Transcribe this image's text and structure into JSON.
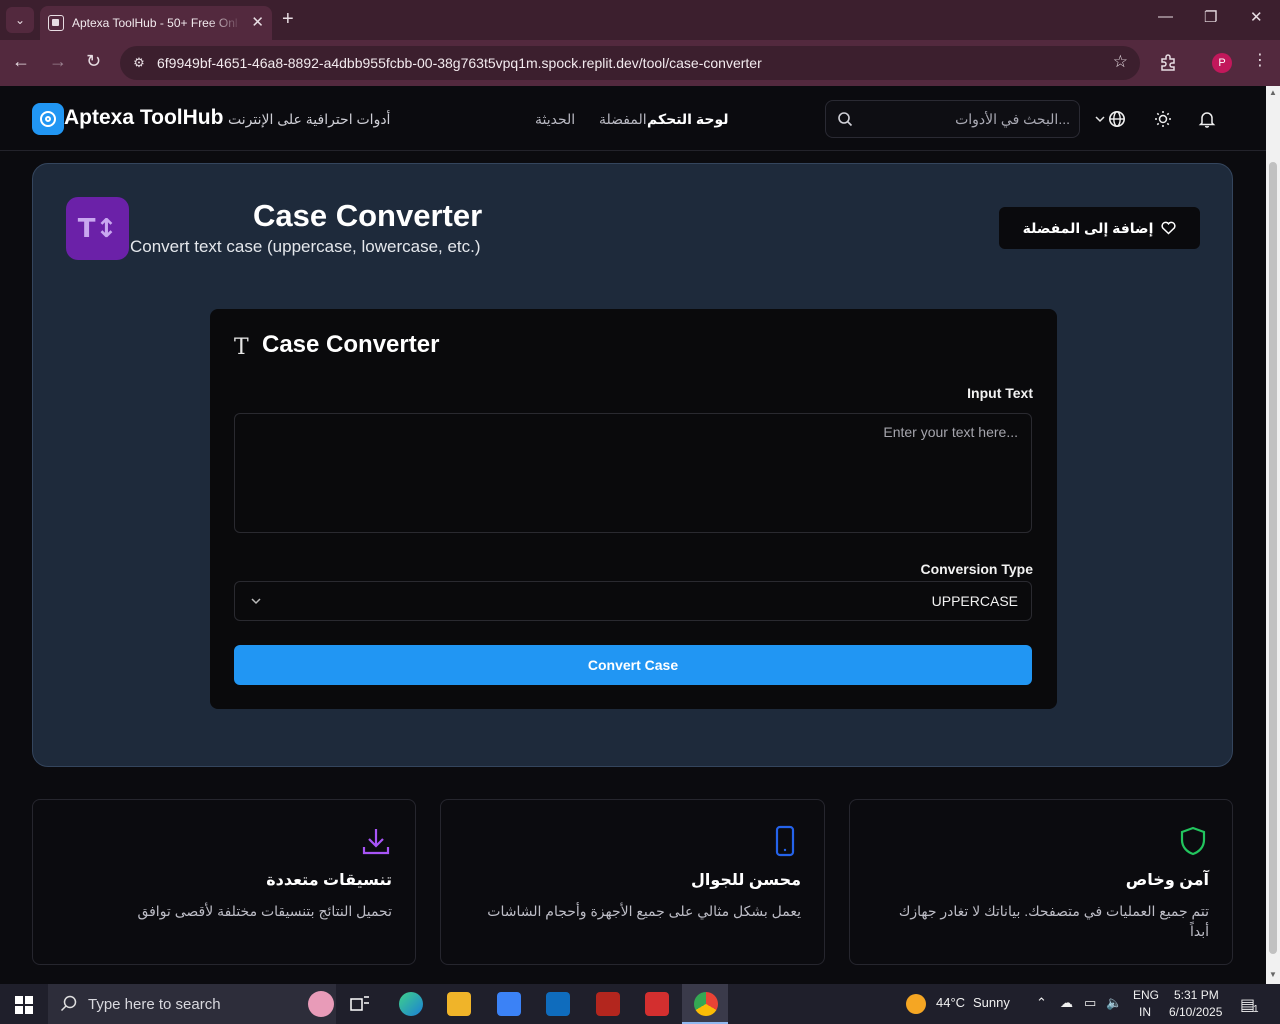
{
  "browser": {
    "tab_title": "Aptexa ToolHub - 50+ Free Onl",
    "url": "6f9949bf-4651-46a8-8892-a4dbb955fcbb-00-38g763t5vpq1m.spock.replit.dev/tool/case-converter",
    "profile_initial": "P"
  },
  "header": {
    "brand": "Aptexa ToolHub",
    "tagline": "أدوات احترافية على الإنترنت",
    "nav": [
      "الحديثة",
      "المفضلة",
      "لوحة التحكم"
    ],
    "search_placeholder": "البحث في الأدوات..."
  },
  "tool": {
    "icon_glyph": "T↕",
    "title": "Case Converter",
    "description": "Convert text case (uppercase, lowercase, etc.)",
    "favorite_label": "إضافة إلى المفضلة"
  },
  "card": {
    "title": "Case Converter",
    "input_label": "Input Text",
    "input_placeholder": "Enter your text here...",
    "conversion_label": "Conversion Type",
    "conversion_value": "UPPERCASE",
    "button_label": "Convert Case"
  },
  "features": [
    {
      "title": "آمن وخاص",
      "desc": "تتم جميع العمليات في متصفحك. بياناتك لا تغادر جهازك أبداً",
      "color": "#22c55e"
    },
    {
      "title": "محسن للجوال",
      "desc": "يعمل بشكل مثالي على جميع الأجهزة وأحجام الشاشات",
      "color": "#2563eb"
    },
    {
      "title": "تنسيقات متعددة",
      "desc": "تحميل النتائج بتنسيقات مختلفة لأقصى توافق",
      "color": "#a855f7"
    }
  ],
  "taskbar": {
    "search_text": "Type here to search",
    "weather_temp": "44°C",
    "weather_text": "Sunny",
    "lang_1": "ENG",
    "lang_2": "IN",
    "time": "5:31 PM",
    "date": "6/10/2025",
    "notif_count": "1"
  },
  "colors": {
    "accent": "#2196f3",
    "tool_icon_bg": "#6b21a8",
    "hero_bg": "#1e2a3b"
  }
}
